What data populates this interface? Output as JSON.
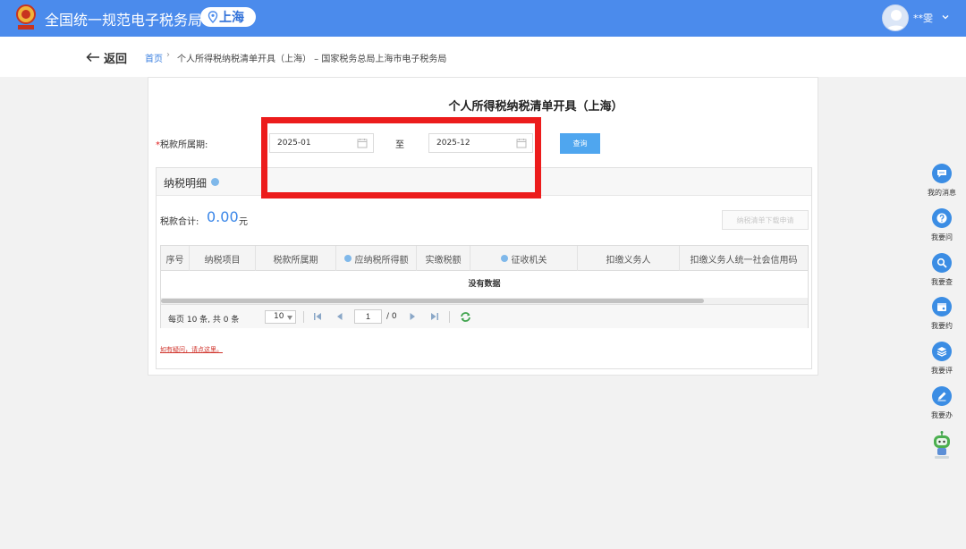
{
  "header": {
    "app_title": "全国统一规范电子税务局",
    "region": "上海",
    "user_name": "**雯"
  },
  "breadcrumb": {
    "back_label": "返回",
    "home": "首页",
    "separator": "›",
    "current": "个人所得税纳税清单开具（上海） – 国家税务总局上海市电子税务局"
  },
  "form": {
    "title": "个人所得税纳税清单开具（上海）",
    "required_mark": "*",
    "period_label": "税款所属期:",
    "date_from": "2025-01",
    "to_label": "至",
    "date_to": "2025-12",
    "query_button": "查询"
  },
  "detail": {
    "section_title": "纳税明细",
    "total_label": "税款合计:",
    "total_value": "0.00",
    "total_unit": "元",
    "download_button": "纳税清单下载申请",
    "columns": [
      "序号",
      "纳税项目",
      "税款所属期",
      "应纳税所得额",
      "实缴税额",
      "征收机关",
      "扣缴义务人",
      "扣缴义务人统一社会信用码"
    ],
    "empty_text": "没有数据",
    "pager": {
      "info": "每页 10 条, 共 0 条",
      "page_size": "10",
      "current_page": "1",
      "total_pages": "/ 0"
    },
    "help_link": "如有疑问，请点这里。"
  },
  "sidebar": {
    "items": [
      {
        "label": "我的消息",
        "icon": "chat-icon"
      },
      {
        "label": "我要问",
        "icon": "question-icon"
      },
      {
        "label": "我要查",
        "icon": "search-icon"
      },
      {
        "label": "我要约",
        "icon": "calendar-icon"
      },
      {
        "label": "我要评",
        "icon": "rate-icon"
      },
      {
        "label": "我要办",
        "icon": "edit-icon"
      }
    ]
  },
  "colors": {
    "header_bg": "#4b8bec",
    "accent": "#3a86e8",
    "annotation": "#ec1c1c",
    "required": "#e02020"
  }
}
